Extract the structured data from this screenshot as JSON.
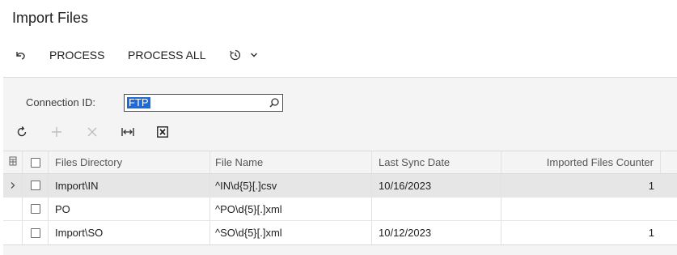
{
  "page": {
    "title": "Import Files"
  },
  "toolbar": {
    "undo_icon": "undo-icon",
    "process_label": "PROCESS",
    "process_all_label": "PROCESS ALL",
    "schedule_icon": "schedule-icon"
  },
  "form": {
    "connection_label": "Connection ID:",
    "connection_value": "FTP"
  },
  "grid_toolbar": {
    "icons": [
      "refresh-icon",
      "add-icon",
      "delete-icon",
      "fit-columns-icon",
      "export-excel-icon"
    ]
  },
  "grid": {
    "columns": [
      "Files Directory",
      "File Name",
      "Last Sync Date",
      "Imported Files Counter"
    ],
    "rows": [
      {
        "directory": "Import\\IN",
        "file_name": "^IN\\d{5}[.]csv",
        "last_sync": "10/16/2023",
        "counter": "1",
        "active": true
      },
      {
        "directory": "PO",
        "file_name": "^PO\\d{5}[.]xml",
        "last_sync": "",
        "counter": "",
        "active": false
      },
      {
        "directory": "Import\\SO",
        "file_name": "^SO\\d{5}[.]xml",
        "last_sync": "10/12/2023",
        "counter": "1",
        "active": false
      }
    ]
  },
  "colors": {
    "selection": "#1f6bd6",
    "active_row": "#e6e6e6",
    "panel": "#f4f4f4"
  }
}
